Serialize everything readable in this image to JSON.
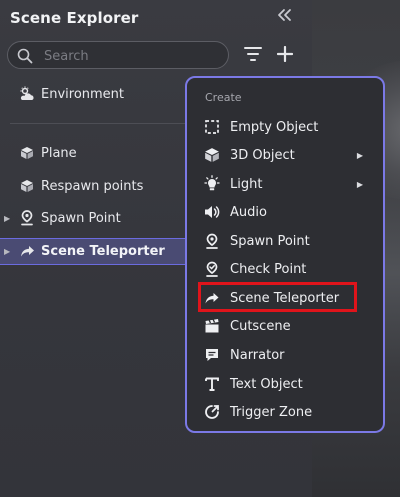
{
  "panel": {
    "title": "Scene Explorer",
    "collapse_icon": "double-chevron-left-icon",
    "search_placeholder": "Search",
    "filter_icon": "filter-icon",
    "add_icon": "plus-icon"
  },
  "tree": {
    "environment": "Environment",
    "items": [
      {
        "label": "Plane",
        "icon": "cube-icon",
        "expandable": false
      },
      {
        "label": "Respawn points",
        "icon": "cube-icon",
        "expandable": false
      },
      {
        "label": "Spawn Point",
        "icon": "location-pin-icon",
        "expandable": true
      },
      {
        "label": "Scene Teleporter",
        "icon": "forward-arrow-icon",
        "expandable": true,
        "selected": true
      }
    ]
  },
  "menu": {
    "header": "Create",
    "items": [
      {
        "label": "Empty Object",
        "icon": "dashed-square-icon",
        "submenu": false
      },
      {
        "label": "3D Object",
        "icon": "cube-icon",
        "submenu": true
      },
      {
        "label": "Light",
        "icon": "light-bulb-icon",
        "submenu": true
      },
      {
        "label": "Audio",
        "icon": "speaker-icon",
        "submenu": false
      },
      {
        "label": "Spawn Point",
        "icon": "location-pin-icon",
        "submenu": false
      },
      {
        "label": "Check Point",
        "icon": "check-pin-icon",
        "submenu": false
      },
      {
        "label": "Scene Teleporter",
        "icon": "forward-arrow-icon",
        "submenu": false,
        "highlighted": true
      },
      {
        "label": "Cutscene",
        "icon": "clapperboard-icon",
        "submenu": false
      },
      {
        "label": "Narrator",
        "icon": "speech-bubble-icon",
        "submenu": false
      },
      {
        "label": "Text Object",
        "icon": "text-t-icon",
        "submenu": false
      },
      {
        "label": "Trigger Zone",
        "icon": "trigger-zone-icon",
        "submenu": false
      }
    ]
  },
  "colors": {
    "accent": "#7b79e6",
    "selected_row": "#4a4b73",
    "highlight_box": "#e0141b"
  }
}
